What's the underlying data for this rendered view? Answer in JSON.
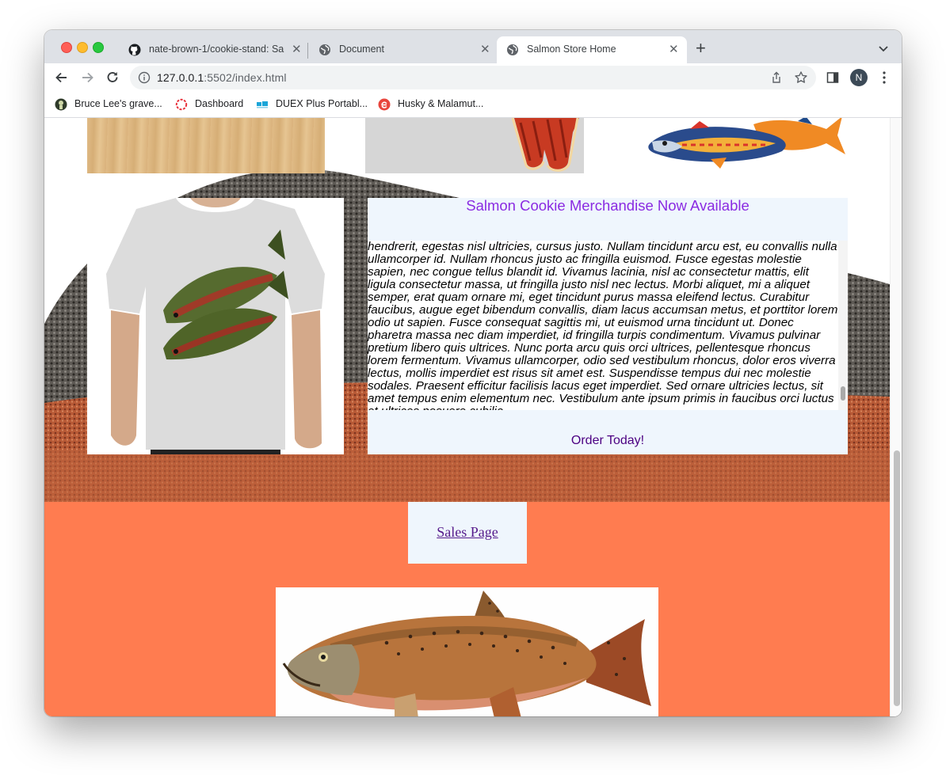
{
  "browser": {
    "tabs": [
      {
        "label": "nate-brown-1/cookie-stand: Sa",
        "icon": "github-icon"
      },
      {
        "label": "Document",
        "icon": "globe-icon"
      },
      {
        "label": "Salmon Store Home",
        "icon": "globe-icon",
        "active": true
      }
    ],
    "url_host": "127.0.0.1",
    "url_rest": ":5502/index.html",
    "profile_initial": "N",
    "bookmarks": [
      {
        "label": "Bruce Lee's grave..."
      },
      {
        "label": "Dashboard"
      },
      {
        "label": "DUEX Plus Portabl..."
      },
      {
        "label": "Husky & Malamut..."
      }
    ]
  },
  "page": {
    "merch_title": "Salmon Cookie Merchandise Now Available",
    "merch_text": "hendrerit, egestas nisl ultricies, cursus justo. Nullam tincidunt arcu est, eu convallis nulla ullamcorper id. Nullam rhoncus justo ac fringilla euismod. Fusce egestas molestie sapien, nec congue tellus blandit id. Vivamus lacinia, nisl ac consectetur mattis, elit ligula consectetur massa, ut fringilla justo nisl nec lectus. Morbi aliquet, mi a aliquet semper, erat quam ornare mi, eget tincidunt purus massa eleifend lectus. Curabitur faucibus, augue eget bibendum convallis, diam lacus accumsan metus, et porttitor lorem odio ut sapien. Fusce consequat sagittis mi, ut euismod urna tincidunt ut. Donec pharetra massa nec diam imperdiet, id fringilla turpis condimentum. Vivamus pulvinar pretium libero quis ultrices. Nunc porta arcu quis orci ultrices, pellentesque rhoncus lorem fermentum. Vivamus ullamcorper, odio sed vestibulum rhoncus, dolor eros viverra lectus, mollis imperdiet est risus sit amet est. Suspendisse tempus dui nec molestie sodales. Praesent efficitur facilisis lacus eget imperdiet. Sed ornare ultricies lectus, sit amet tempus enim elementum nec. Vestibulum ante ipsum primis in faucibus orci luctus et ultrices posuere cubilia",
    "order_cta": "Order Today!",
    "sales_link": "Sales Page"
  },
  "colors": {
    "panel_bg": "#eff6fd",
    "title": "#8a2be2",
    "cta": "#4b0082",
    "footer_bg": "#ff7c50"
  }
}
